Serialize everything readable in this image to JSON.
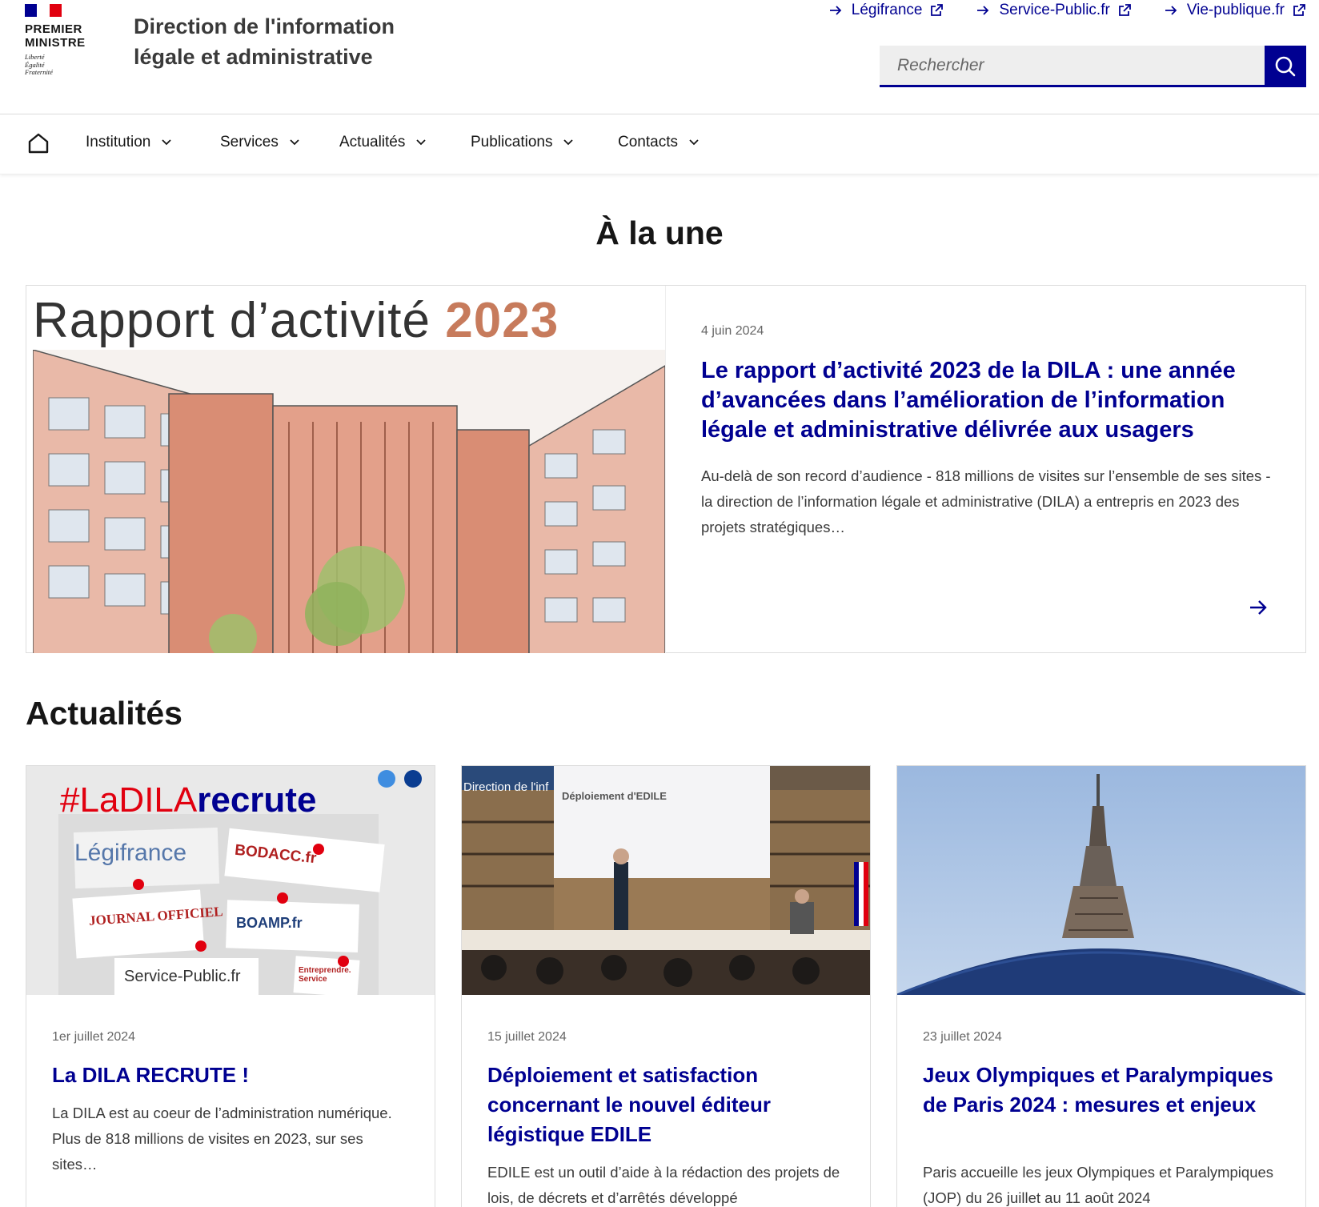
{
  "header": {
    "logo_line1": "PREMIER",
    "logo_line2": "MINISTRE",
    "motto1": "Liberté",
    "motto2": "Égalité",
    "motto3": "Fraternité",
    "site_title_line1": "Direction de l'information",
    "site_title_line2": "légale et administrative",
    "ext_links": [
      {
        "label": "Légifrance"
      },
      {
        "label": "Service-Public.fr"
      },
      {
        "label": "Vie-publique.fr"
      }
    ],
    "search_placeholder": "Rechercher",
    "colors": {
      "blue": "#000091",
      "red": "#e1000f"
    }
  },
  "nav": {
    "home_icon": "home-icon",
    "items": [
      {
        "label": "Institution"
      },
      {
        "label": "Services"
      },
      {
        "label": "Actualités"
      },
      {
        "label": "Publications"
      },
      {
        "label": "Contacts"
      }
    ]
  },
  "une": {
    "title": "À la une",
    "image_title": "Rapport d’activité",
    "image_year": "2023",
    "date": "4 juin 2024",
    "headline": "Le rapport d’activité 2023 de la DILA : une année d’avancées dans l’amélioration de l’information légale et administrative délivrée aux usagers",
    "text": "Au-delà de son record d’audience - 818 millions de visites sur l’ensemble de ses sites - la direction de l’information légale et administrative (DILA) a entrepris en 2023 des projets stratégiques…"
  },
  "actualites": {
    "title": "Actualités",
    "cards": [
      {
        "date": "1er juillet 2024",
        "title": "La DILA RECRUTE !",
        "text": "La DILA est au coeur de l’administration numérique. Plus de 818 millions de visites en 2023, sur ses sites…",
        "img_hashtag": "#LaDILA",
        "img_hashtag_bold": "recrute",
        "img_labels": [
          "Légifrance",
          "BODACC.fr",
          "JOURNAL OFFICIEL",
          "BOAMP.fr",
          "Service-Public.fr",
          "Entreprendre. Service"
        ]
      },
      {
        "date": "15 juillet 2024",
        "title": "Déploiement et satisfaction concernant le nouvel éditeur légistique EDILE",
        "text": "EDILE est un outil d’aide à la rédaction des projets de lois, de décrets et d’arrêtés développé",
        "img_screen_text": "Déploiement d'EDILE",
        "img_banner": "Direction de l'inf"
      },
      {
        "date": "23 juillet 2024",
        "title": "Jeux Olympiques et Paralympiques de Paris 2024 : mesures et enjeux",
        "text": "Paris accueille les jeux Olympiques et Paralympiques (JOP) du 26 juillet au 11 août 2024"
      }
    ]
  }
}
